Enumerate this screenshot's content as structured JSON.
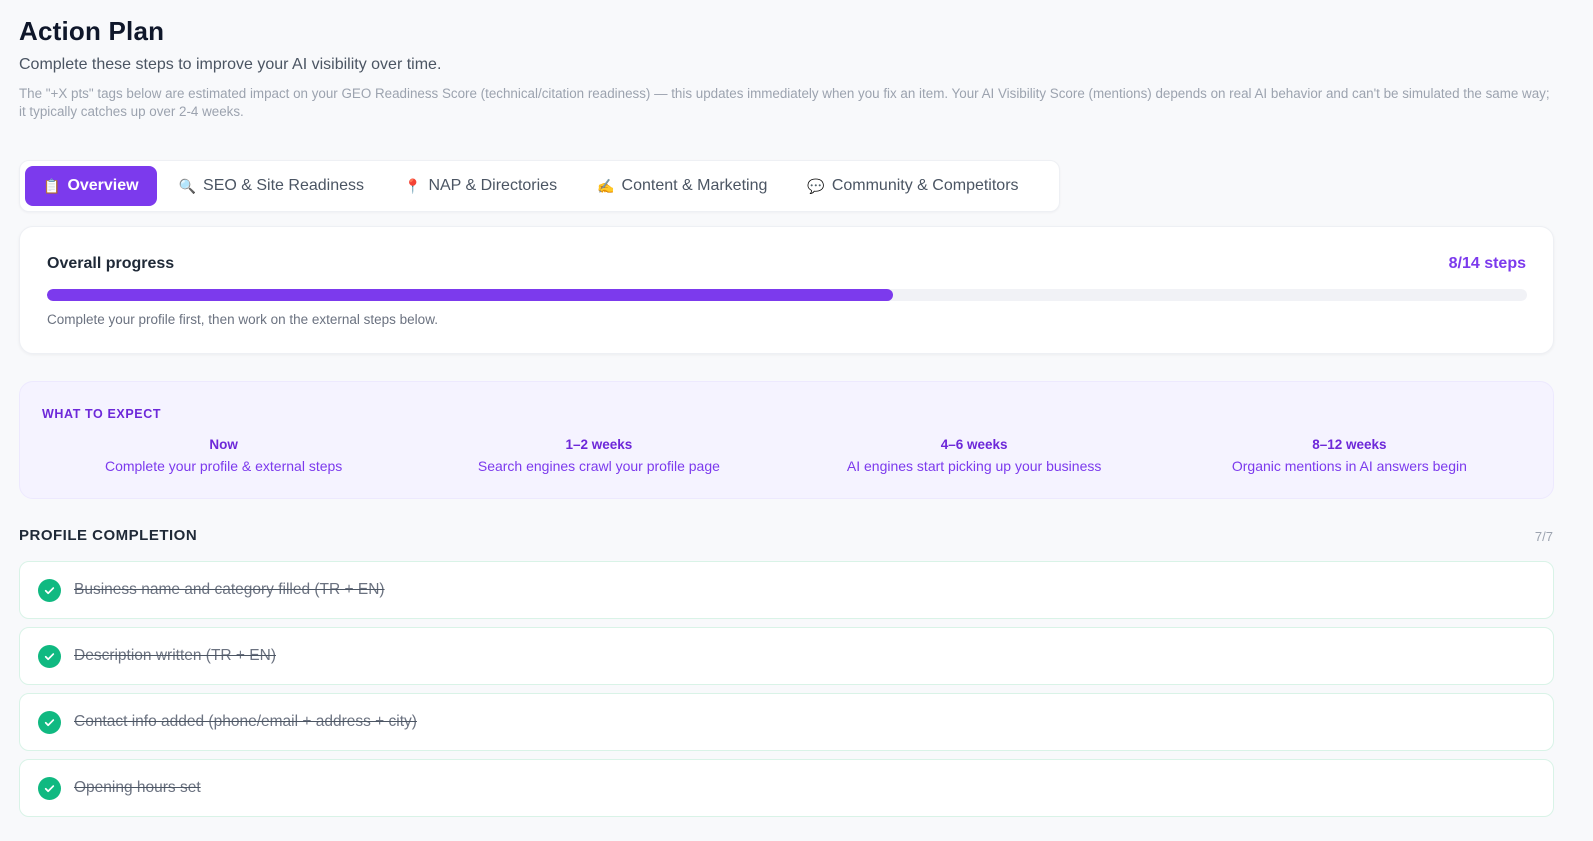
{
  "page": {
    "title": "Action Plan",
    "subtitle": "Complete these steps to improve your AI visibility over time.",
    "note": "The \"+X pts\" tags below are estimated impact on your GEO Readiness Score (technical/citation readiness) — this updates immediately when you fix an item. Your AI Visibility Score (mentions) depends on real AI behavior and can't be simulated the same way; it typically catches up over 2-4 weeks."
  },
  "tabs": [
    {
      "icon": "📋",
      "icon_name": "clipboard-icon",
      "label": "Overview",
      "active": true
    },
    {
      "icon": "🔍",
      "icon_name": "magnifier-icon",
      "label": "SEO & Site Readiness",
      "active": false
    },
    {
      "icon": "📍",
      "icon_name": "pin-icon",
      "label": "NAP & Directories",
      "active": false
    },
    {
      "icon": "✍️",
      "icon_name": "writing-hand-icon",
      "label": "Content & Marketing",
      "active": false
    },
    {
      "icon": "💬",
      "icon_name": "speech-bubble-icon",
      "label": "Community & Competitors",
      "active": false
    }
  ],
  "progress": {
    "label": "Overall progress",
    "count_text": "8/14 steps",
    "completed": 8,
    "total": 14,
    "hint": "Complete your profile first, then work on the external steps below."
  },
  "expect": {
    "title": "WHAT TO EXPECT",
    "stages": [
      {
        "when": "Now",
        "what": "Complete your profile & external steps"
      },
      {
        "when": "1–2 weeks",
        "what": "Search engines crawl your profile page"
      },
      {
        "when": "4–6 weeks",
        "what": "AI engines start picking up your business"
      },
      {
        "when": "8–12 weeks",
        "what": "Organic mentions in AI answers begin"
      }
    ]
  },
  "profile": {
    "heading": "PROFILE COMPLETION",
    "count": "7/7",
    "items": [
      {
        "label": "Business name and category filled (TR + EN)",
        "done": true
      },
      {
        "label": "Description written (TR + EN)",
        "done": true
      },
      {
        "label": "Contact info added (phone/email + address + city)",
        "done": true
      },
      {
        "label": "Opening hours set",
        "done": true
      }
    ]
  },
  "colors": {
    "accent": "#7c3aed",
    "success": "#10b981"
  }
}
